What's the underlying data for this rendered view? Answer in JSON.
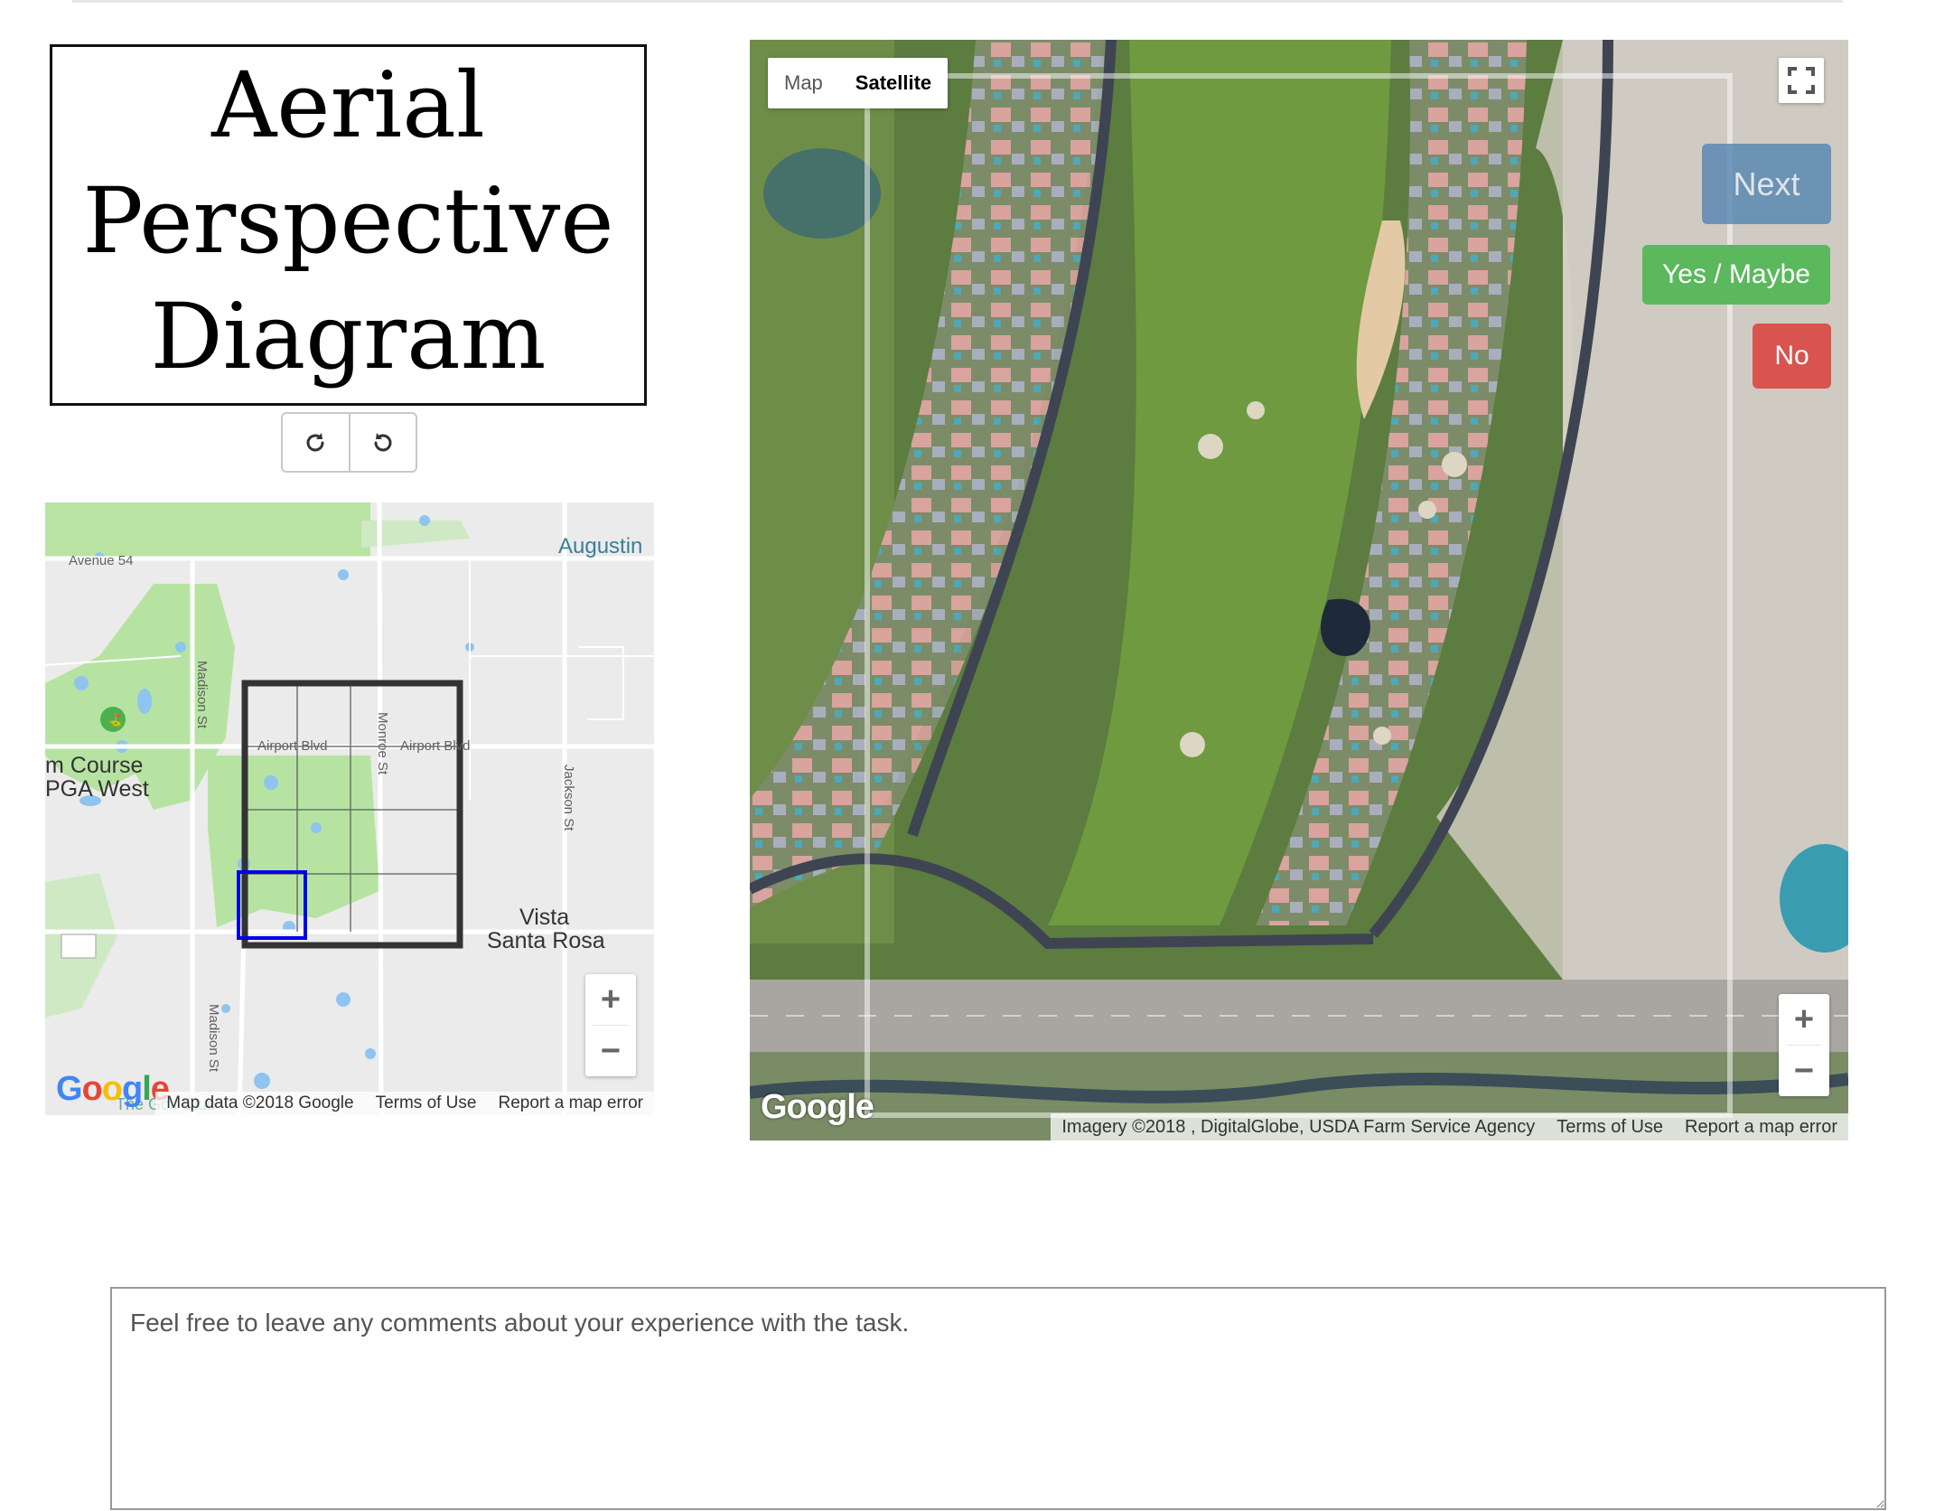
{
  "title": {
    "text": "Aerial\nPerspective\nDiagram"
  },
  "rotate": {
    "clockwise_icon": "rotate-cw-icon",
    "counterclockwise_icon": "rotate-ccw-icon"
  },
  "mini_map": {
    "labels": {
      "avenue54": "Avenue 54",
      "augustine": "Augustin",
      "madison1": "Madison St",
      "madison2": "Madison St",
      "monroe": "Monroe St",
      "airport1": "Airport Blvd",
      "airport2": "Airport Blvd",
      "jackson": "Jackson St",
      "course": "m Course",
      "pga": "PGA West",
      "vista": "Vista",
      "santa_rosa": "Santa Rosa",
      "golf_club": "The Golf Club"
    },
    "zoom_in": "+",
    "zoom_out": "−",
    "footer": {
      "map_data": "Map data ©2018 Google",
      "terms": "Terms of Use",
      "report": "Report a map error"
    },
    "logo": "Google",
    "colors": {
      "grid": "#333333",
      "selected_cell": "#0000ee",
      "parks": "#b6e3a2",
      "water": "#8ec4ef"
    }
  },
  "satellite": {
    "map_type": {
      "map": "Map",
      "satellite": "Satellite"
    },
    "buttons": {
      "next": "Next",
      "yes": "Yes / Maybe",
      "no": "No"
    },
    "zoom_in": "+",
    "zoom_out": "−",
    "footer": {
      "imagery": "Imagery ©2018 , DigitalGlobe, USDA Farm Service Agency",
      "terms": "Terms of Use",
      "report": "Report a map error"
    },
    "logo": "Google",
    "colors": {
      "next": "#4c7fb0",
      "yes": "#5cb85c",
      "no": "#d9534f"
    }
  },
  "comments": {
    "placeholder": "Feel free to leave any comments about your experience with the task."
  }
}
